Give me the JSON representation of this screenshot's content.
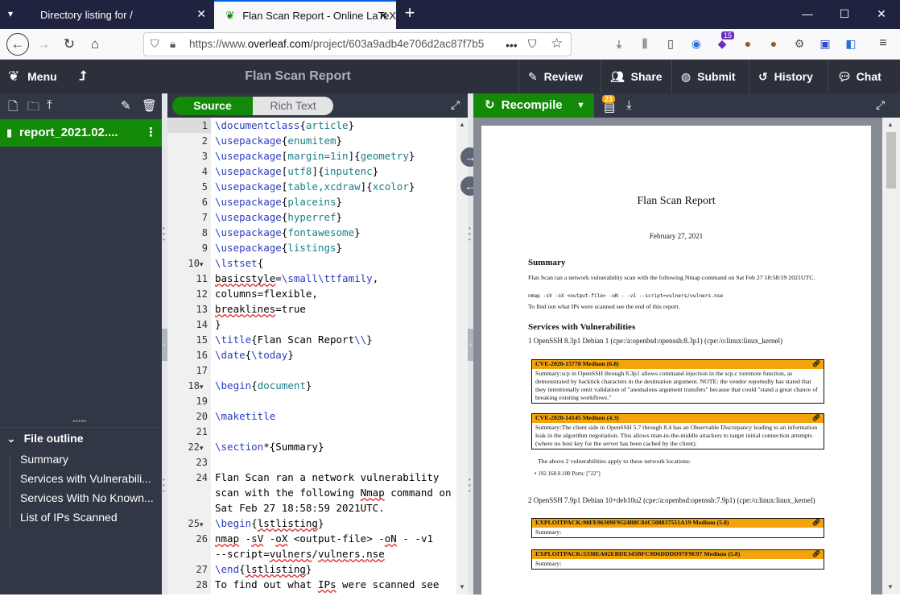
{
  "browser": {
    "tabs": [
      {
        "title": "Directory listing for /"
      },
      {
        "title": "Flan Scan Report - Online LaTeX"
      }
    ],
    "url_prefix": "https://www.",
    "url_domain": "overleaf.com",
    "url_path": "/project/603a9adb4e706d2ac87f7b5",
    "badge_count": "15"
  },
  "toolbar": {
    "menu": "Menu",
    "project_title": "Flan Scan Report",
    "review": "Review",
    "share": "Share",
    "submit": "Submit",
    "history": "History",
    "chat": "Chat"
  },
  "filetree": {
    "active_file": "report_2021.02....",
    "outline_header": "File outline",
    "outline": [
      "Summary",
      "Services with Vulnerabili...",
      "Services With No Known...",
      "List of IPs Scanned"
    ]
  },
  "editor": {
    "source_label": "Source",
    "rich_text_label": "Rich Text",
    "gutter": [
      "1",
      "2",
      "3",
      "4",
      "5",
      "6",
      "7",
      "8",
      "9",
      "10",
      "11",
      "12",
      "13",
      "14",
      "15",
      "16",
      "17",
      "18",
      "19",
      "20",
      "21",
      "22",
      "23",
      "24",
      "",
      "",
      "25",
      "26",
      "",
      "27",
      "28"
    ]
  },
  "pdf": {
    "recompile_label": "Recompile",
    "log_count": "23",
    "title": "Flan Scan Report",
    "date": "February 27, 2021",
    "summary_heading": "Summary",
    "summary_text": "Flan Scan ran a network vulnerability scan with the following Nmap command on Sat Feb 27 18:58:59 2021UTC.",
    "nmap_cmd": "nmap -sV -oX <output-file> -oN - -v1 --script=vulners/vulners.nse",
    "ips_note": "To find out what IPs were scanned see the end of this report.",
    "services_heading": "Services with Vulnerabilities",
    "service1": "1   OpenSSH 8.3p1 Debian 1 (cpe:/a:openbsd:openssh:8.3p1) (cpe:/o:linux:linux_kernel)",
    "cve1_title": "CVE-2020-15778 Medium (6.8)",
    "cve1_text": "Summary:scp in OpenSSH through 8.3p1 allows command injection in the scp.c toremote function, as demonstrated by backtick characters in the destination argument.  NOTE: the vendor reportedly has stated that they intentionally omit validation of \"anomalous argument transfers\" because that could \"stand a great chance of breaking existing workflows.\"",
    "cve2_title": "CVE-2020-14145 Medium (4.3)",
    "cve2_text": "Summary:The client side in OpenSSH 5.7 through 8.4 has an Observable Discrepancy leading to an information leak in the algorithm negotiation. This allows man-in-the-middle attackers to target initial connection attempts (where no host key for the server has been cached by the client).",
    "vuln_locations": "The above 2 vulnerabilities apply to these network locations:",
    "location1": "192.168.0.100 Ports: [\"22\"]",
    "service2": "2   OpenSSH 7.9p1 Debian 10+deb10u2 (cpe:/a:openbsd:openssh:7.9p1) (cpe:/o:linux:linux_kernel)",
    "exp1_title": "EXPLOITPACK:98FE96309F9524B8C84C508837551A19 Medium (5.8)",
    "exp2_title": "EXPLOITPACK:5330EA02EBDE345BFC9D6DDDD97F9E97 Medium (5.8)",
    "summary_label": "Summary:"
  }
}
